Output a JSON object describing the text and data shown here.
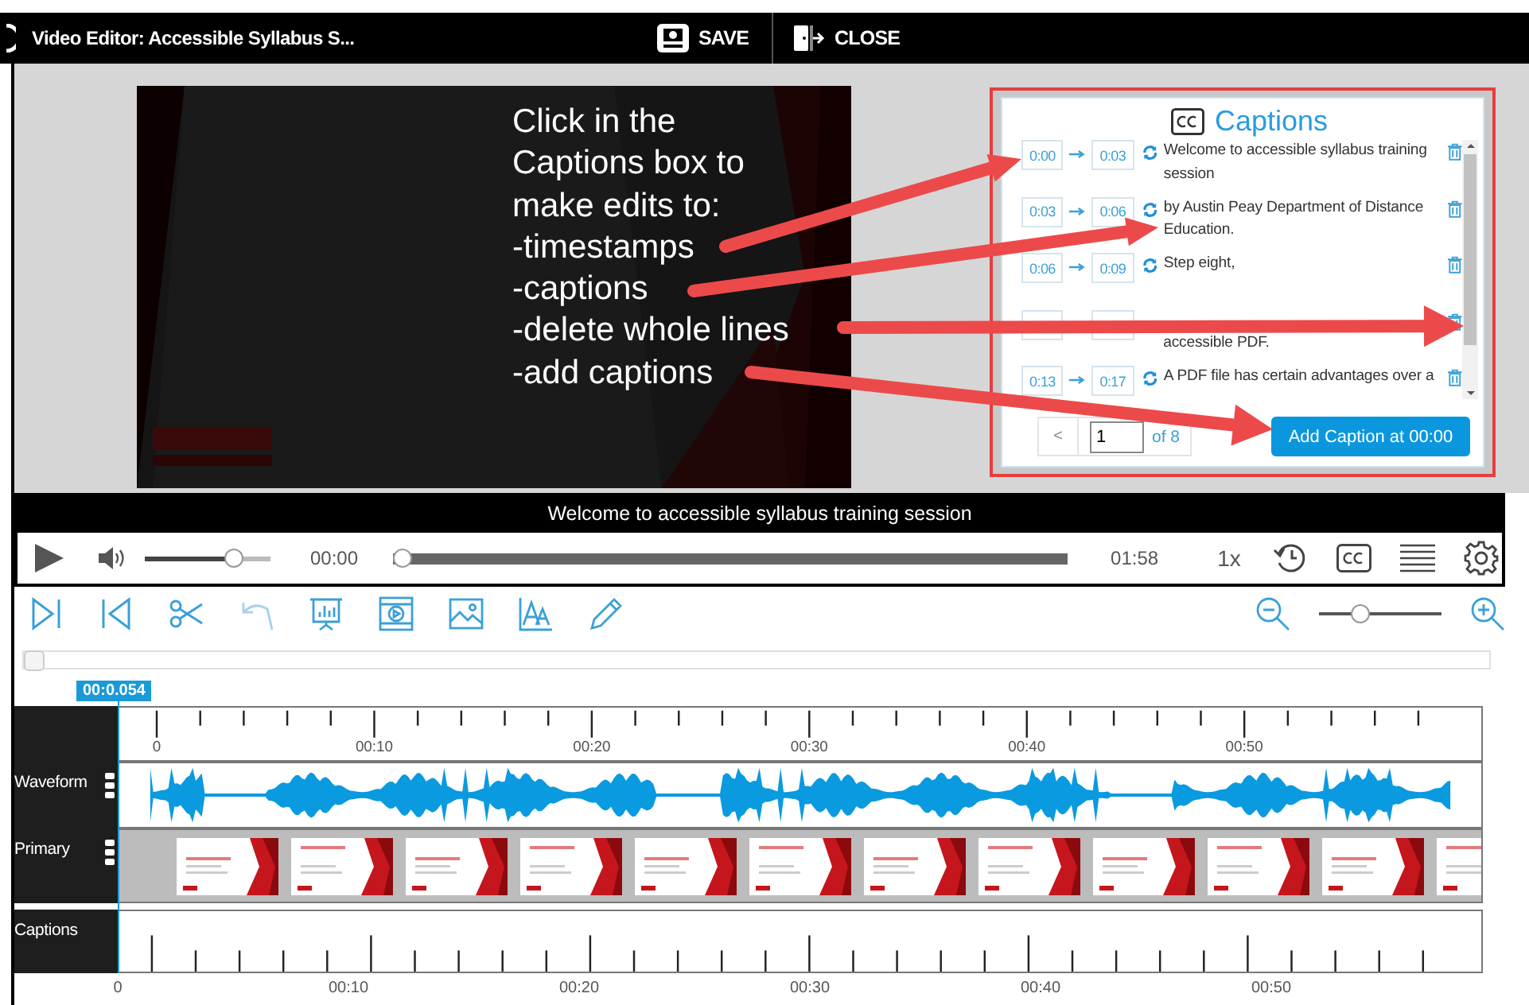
{
  "header": {
    "title": "Video Editor: Accessible Syllabus S...",
    "actions": [
      {
        "kind": "save",
        "label": "SAVE"
      },
      {
        "kind": "close",
        "label": "CLOSE"
      }
    ]
  },
  "annotation": {
    "lines": [
      "Click in the",
      "Captions box to",
      "make edits to:",
      "-timestamps",
      "-captions",
      "-delete whole lines",
      "-add captions"
    ]
  },
  "captions_panel": {
    "title": "Captions",
    "rows": [
      {
        "kind": "full",
        "start": "0:00",
        "end": "0:03",
        "text": "Welcome to accessible syllabus training session"
      },
      {
        "kind": "full",
        "start": "0:03",
        "end": "0:06",
        "text": "by Austin Peay Department of Distance Education."
      },
      {
        "kind": "full",
        "start": "0:06",
        "end": "0:09",
        "text": "Step eight,"
      },
      {
        "kind": "partial",
        "text": "accessible PDF."
      },
      {
        "kind": "full",
        "start": "0:13",
        "end": "0:17",
        "text": "A PDF file has certain advantages over a"
      }
    ],
    "prev": "<",
    "page": "1",
    "page_total": "of 8",
    "add_button": "Add Caption at 00:00"
  },
  "player": {
    "caption": "Welcome to accessible syllabus training session",
    "volume": {
      "level": 0.74
    },
    "current_time": "00:00",
    "progress": {
      "level": 0
    },
    "duration": "01:58",
    "speed": "1x"
  },
  "toolbar": {
    "zoom": {
      "level": 0.31
    }
  },
  "timeline": {
    "playhead": "00:0.054",
    "ruler_labels": [
      "0",
      "00:10",
      "00:20",
      "00:30",
      "00:40",
      "00:50"
    ],
    "tracks": [
      {
        "kind": "waveform",
        "label": "Waveform"
      },
      {
        "kind": "slides",
        "label": "Primary"
      },
      {
        "kind": "captions",
        "label": "Captions"
      }
    ],
    "bottom_labels": [
      "0",
      "00:10",
      "00:20",
      "00:30",
      "00:40",
      "00:50"
    ]
  }
}
